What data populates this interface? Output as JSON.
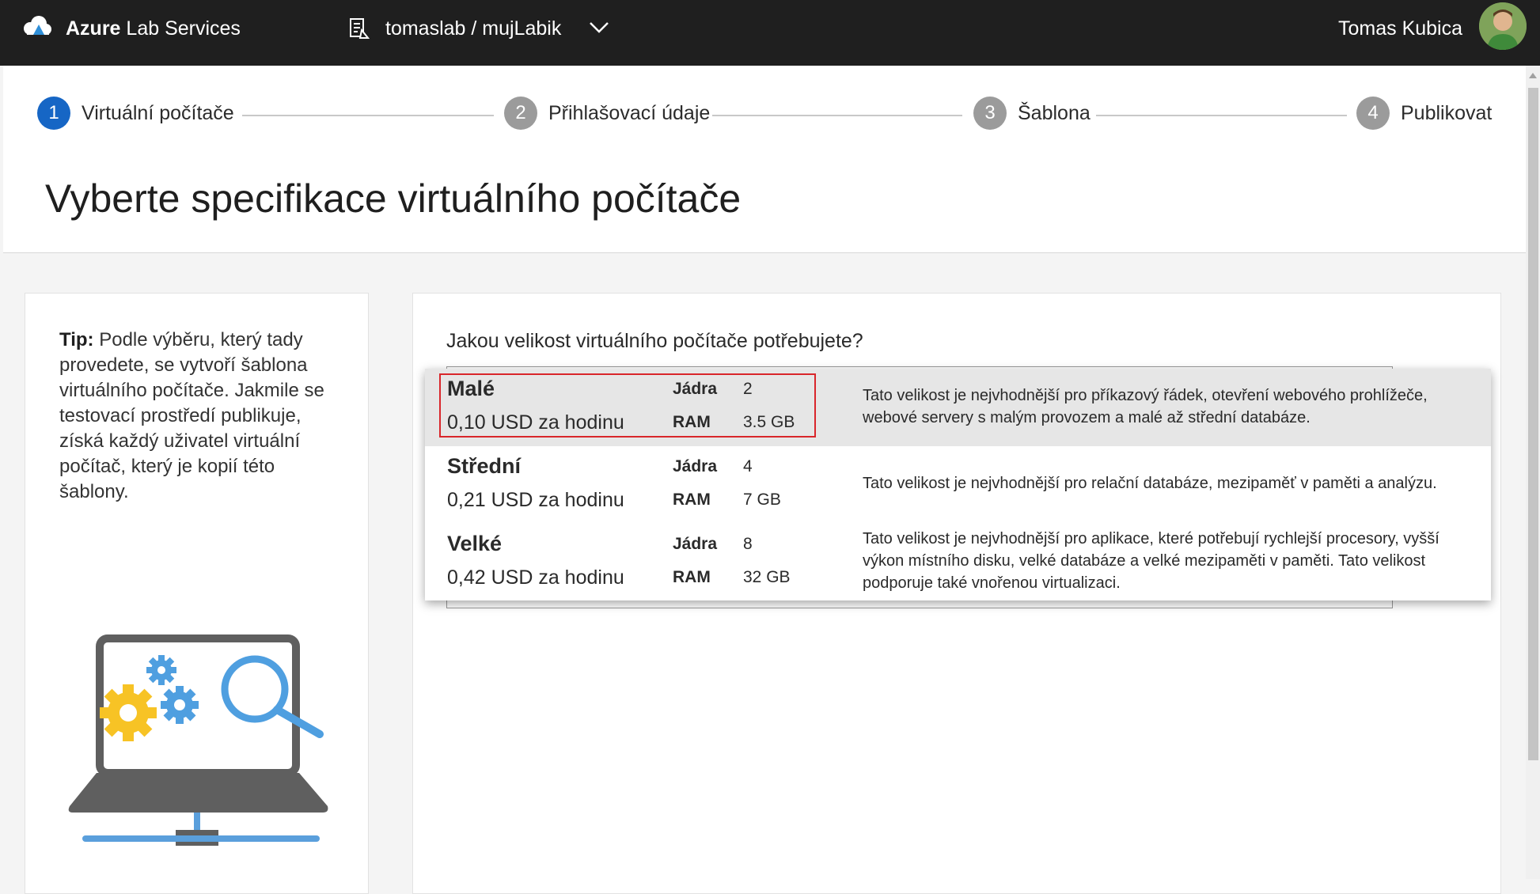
{
  "header": {
    "app_title_bold": "Azure",
    "app_title_rest": " Lab Services",
    "lab_path": "tomaslab / mujLabik",
    "user_name": "Tomas Kubica"
  },
  "stepper": {
    "steps": [
      {
        "number": "1",
        "label": "Virtuální počítače",
        "state": "active"
      },
      {
        "number": "2",
        "label": "Přihlašovací údaje",
        "state": "inactive"
      },
      {
        "number": "3",
        "label": "Šablona",
        "state": "inactive"
      },
      {
        "number": "4",
        "label": "Publikovat",
        "state": "inactive"
      }
    ]
  },
  "page_title": "Vyberte specifikace virtuálního počítače",
  "tip": {
    "label": "Tip:",
    "text": " Podle výběru, který tady provedete, se vytvoří šablona virtuálního počítače. Jakmile se testovací prostředí publikuje, získá každý uživatel virtuální počítač, který je kopií této šablony."
  },
  "question": "Jakou velikost virtuálního počítače potřebujete?",
  "sizes": [
    {
      "name": "Malé",
      "price": "0,10 USD za hodinu",
      "cores_label": "Jádra",
      "cores": "2",
      "ram_label": "RAM",
      "ram": "3.5 GB",
      "description": "Tato velikost je nejvhodnější pro příkazový řádek, otevření webového prohlížeče, webové servery s malým provozem a malé až střední databáze.",
      "selected": true
    },
    {
      "name": "Střední",
      "price": "0,21 USD za hodinu",
      "cores_label": "Jádra",
      "cores": "4",
      "ram_label": "RAM",
      "ram": "7 GB",
      "description": "Tato velikost je nejvhodnější pro relační databáze, mezipaměť v paměti a analýzu.",
      "selected": false
    },
    {
      "name": "Velké",
      "price": "0,42 USD za hodinu",
      "cores_label": "Jádra",
      "cores": "8",
      "ram_label": "RAM",
      "ram": "32 GB",
      "description": "Tato velikost je nejvhodnější pro aplikace, které potřebují rychlejší procesory, vyšší výkon místního disku, velké databáze a velké mezipaměti v paměti. Tato velikost podporuje také vnořenou virtualizaci.",
      "selected": false
    }
  ],
  "colors": {
    "accent": "#1666c5",
    "topbar": "#1f1f1f",
    "highlight": "#d9262b",
    "selected_row": "#e6e6e6"
  },
  "icons": {
    "logo": "azure-lab-cloud-icon",
    "lab": "lab-document-icon",
    "chevron": "chevron-down-icon",
    "illustration": "laptop-settings-search-icon"
  }
}
